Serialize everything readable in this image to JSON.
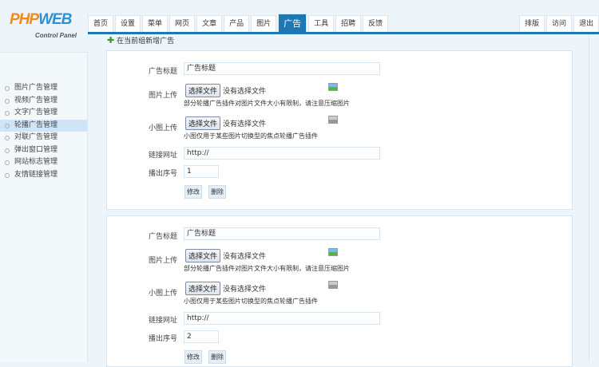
{
  "logo": {
    "text": "PHPWEB",
    "sub": "Control Panel"
  },
  "nav": {
    "tabs": [
      "首页",
      "设置",
      "菜单",
      "网页",
      "文章",
      "产品",
      "图片",
      "广告",
      "工具",
      "招聘",
      "反馈"
    ],
    "active": 7,
    "right": [
      "排版",
      "访问",
      "退出"
    ]
  },
  "sidebar": {
    "items": [
      "图片广告管理",
      "视频广告管理",
      "文字广告管理",
      "轮播广告管理",
      "对联广告管理",
      "弹出窗口管理",
      "网站标志管理",
      "友情链接管理"
    ],
    "active": 3
  },
  "add_link": "在当前组新增广告",
  "labels": {
    "title": "广告标题",
    "image": "图片上传",
    "thumb": "小图上传",
    "link": "链接网址",
    "order": "播出序号",
    "choose": "选择文件",
    "nofile": "没有选择文件",
    "image_note": "部分轮播广告插件对图片文件大小有限制，请注意压缩图片",
    "thumb_note": "小图仅用于某些图片切换型的焦点轮播广告插件",
    "edit": "修改",
    "delete": "删除"
  },
  "ads": [
    {
      "title": "广告标题",
      "link": "http://",
      "order": "1"
    },
    {
      "title": "广告标题",
      "link": "http://",
      "order": "2"
    }
  ],
  "colors": {
    "accent": "#1e77b5"
  }
}
